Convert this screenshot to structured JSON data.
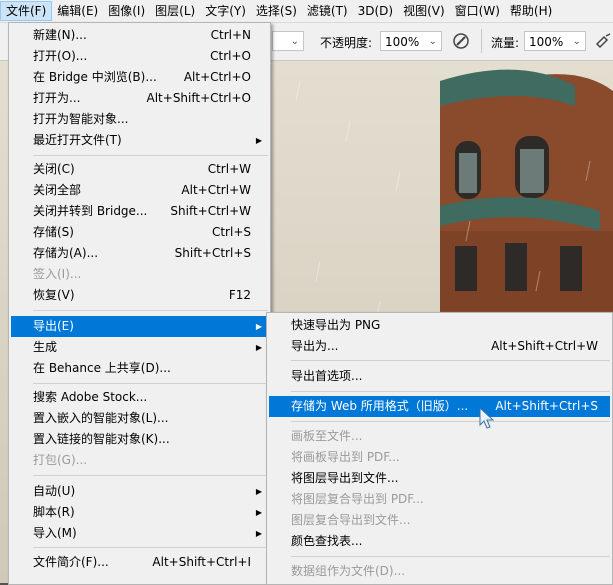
{
  "menubar": {
    "items": [
      "文件(F)",
      "编辑(E)",
      "图像(I)",
      "图层(L)",
      "文字(Y)",
      "选择(S)",
      "滤镜(T)",
      "3D(D)",
      "视图(V)",
      "窗口(W)",
      "帮助(H)"
    ]
  },
  "options": {
    "opacity_label": "不透明度:",
    "opacity_value": "100%",
    "flow_label": "流量:",
    "flow_value": "100%"
  },
  "file_menu": {
    "items": [
      {
        "label": "新建(N)...",
        "shortcut": "Ctrl+N"
      },
      {
        "label": "打开(O)...",
        "shortcut": "Ctrl+O"
      },
      {
        "label": "在 Bridge 中浏览(B)...",
        "shortcut": "Alt+Ctrl+O"
      },
      {
        "label": "打开为...",
        "shortcut": "Alt+Shift+Ctrl+O"
      },
      {
        "label": "打开为智能对象...",
        "shortcut": ""
      },
      {
        "label": "最近打开文件(T)",
        "shortcut": ""
      },
      {
        "label": "关闭(C)",
        "shortcut": "Ctrl+W"
      },
      {
        "label": "关闭全部",
        "shortcut": "Alt+Ctrl+W"
      },
      {
        "label": "关闭并转到 Bridge...",
        "shortcut": "Shift+Ctrl+W"
      },
      {
        "label": "存储(S)",
        "shortcut": "Ctrl+S"
      },
      {
        "label": "存储为(A)...",
        "shortcut": "Shift+Ctrl+S"
      },
      {
        "label": "签入(I)...",
        "shortcut": ""
      },
      {
        "label": "恢复(V)",
        "shortcut": "F12"
      },
      {
        "label": "导出(E)",
        "shortcut": ""
      },
      {
        "label": "生成",
        "shortcut": ""
      },
      {
        "label": "在 Behance 上共享(D)...",
        "shortcut": ""
      },
      {
        "label": "搜索 Adobe Stock...",
        "shortcut": ""
      },
      {
        "label": "置入嵌入的智能对象(L)...",
        "shortcut": ""
      },
      {
        "label": "置入链接的智能对象(K)...",
        "shortcut": ""
      },
      {
        "label": "打包(G)...",
        "shortcut": ""
      },
      {
        "label": "自动(U)",
        "shortcut": ""
      },
      {
        "label": "脚本(R)",
        "shortcut": ""
      },
      {
        "label": "导入(M)",
        "shortcut": ""
      },
      {
        "label": "文件简介(F)...",
        "shortcut": "Alt+Shift+Ctrl+I"
      }
    ]
  },
  "export_menu": {
    "items": [
      {
        "label": "快速导出为 PNG",
        "shortcut": ""
      },
      {
        "label": "导出为...",
        "shortcut": "Alt+Shift+Ctrl+W"
      },
      {
        "label": "导出首选项...",
        "shortcut": ""
      },
      {
        "label": "存储为 Web 所用格式（旧版）...",
        "shortcut": "Alt+Shift+Ctrl+S"
      },
      {
        "label": "画板至文件...",
        "shortcut": ""
      },
      {
        "label": "将画板导出到 PDF...",
        "shortcut": ""
      },
      {
        "label": "将图层导出到文件...",
        "shortcut": ""
      },
      {
        "label": "将图层复合导出到 PDF...",
        "shortcut": ""
      },
      {
        "label": "图层复合导出到文件...",
        "shortcut": ""
      },
      {
        "label": "颜色查找表...",
        "shortcut": ""
      },
      {
        "label": "数据组作为文件(D)...",
        "shortcut": ""
      }
    ]
  },
  "colors": {
    "highlight": "#0078d7",
    "menu_bg": "#f0f0f0",
    "disabled_text": "#9a9a9a"
  }
}
